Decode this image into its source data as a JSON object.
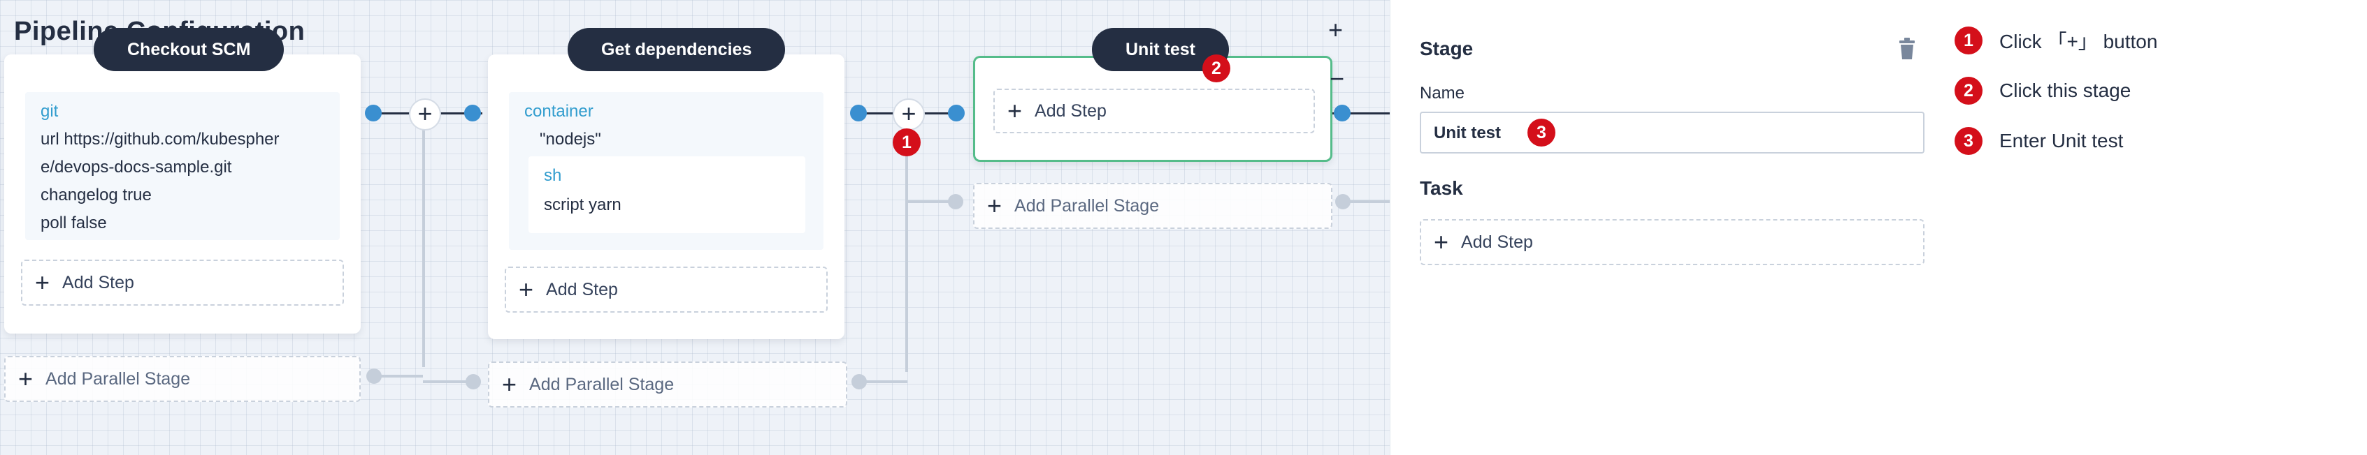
{
  "canvas": {
    "page_title": "Pipeline Configuration",
    "stages": [
      {
        "name": "Checkout SCM",
        "step": {
          "type": "git",
          "lines": [
            "url    https://github.com/kubespher",
            "e/devops-docs-sample.git",
            "changelog    true",
            "poll    false"
          ]
        },
        "add_step": "Add Step",
        "add_parallel": "Add Parallel Stage"
      },
      {
        "name": "Get dependencies",
        "step": {
          "type": "container",
          "arg": "\"nodejs\"",
          "inner_type": "sh",
          "inner_line": "script    yarn"
        },
        "add_step": "Add Step",
        "add_parallel": "Add Parallel Stage"
      },
      {
        "name": "Unit test",
        "add_step": "Add Step",
        "add_parallel": "Add Parallel Stage"
      }
    ],
    "add_symbol": "+",
    "zoom_in": "+",
    "zoom_out": "−"
  },
  "panel": {
    "title": "Stage",
    "name_label": "Name",
    "name_value": "Unit test",
    "task_title": "Task",
    "add_step": "Add Step"
  },
  "badges": {
    "one": "1",
    "two": "2",
    "three": "3"
  },
  "instructions": [
    {
      "num": "1",
      "text": "Click 「+」 button"
    },
    {
      "num": "2",
      "text": "Click this stage"
    },
    {
      "num": "3",
      "text": "Enter Unit test"
    }
  ],
  "colors": {
    "pill": "#242e42",
    "accent_blue": "#329dce",
    "selected_border": "#55bc8a",
    "badge_red": "#d40f1a"
  }
}
